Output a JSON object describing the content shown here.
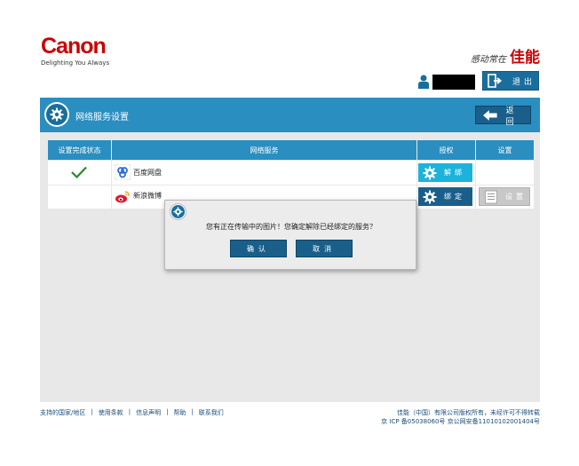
{
  "header": {
    "brand": "Canon",
    "tagline": "Delighting You Always",
    "slogan_small": "感动常在",
    "slogan_big": "佳能",
    "logout_label": "退出"
  },
  "panel": {
    "title": "网络服务设置",
    "back_label": "返回"
  },
  "table": {
    "headers": [
      "设置完成状态",
      "网络服务",
      "授权",
      "设置"
    ],
    "rows": [
      {
        "status": "checkmark",
        "service": "百度网盘",
        "auth_label": "解绑",
        "settings_label": ""
      },
      {
        "status": "",
        "service": "新浪微博",
        "auth_label": "绑定",
        "settings_label": "设置"
      }
    ]
  },
  "dialog": {
    "message": "您有正在传输中的图片！您确定解除已经绑定的服务？",
    "confirm_label": "确认",
    "cancel_label": "取消"
  },
  "footer": {
    "links": [
      "支持的国家/地区",
      "使用条款",
      "信息声明",
      "帮助",
      "联系我们"
    ],
    "copyright": "佳能（中国）有限公司版权所有，未经许可不得转载",
    "icp": "京 ICP 备05038060号 京公网安备11010102001404号"
  },
  "colors": {
    "brand_red": "#cc0000",
    "primary_blue": "#2a8ec0",
    "dark_blue": "#1a5f8a",
    "unbind_cyan": "#1bb3db",
    "disabled_gray": "#c8c8c8",
    "check_green": "#2a8a2a"
  },
  "icons": [
    "user-icon",
    "logout-icon",
    "gear-icon",
    "back-arrow-icon",
    "check-icon",
    "baidu-icon",
    "weibo-icon",
    "list-icon"
  ]
}
